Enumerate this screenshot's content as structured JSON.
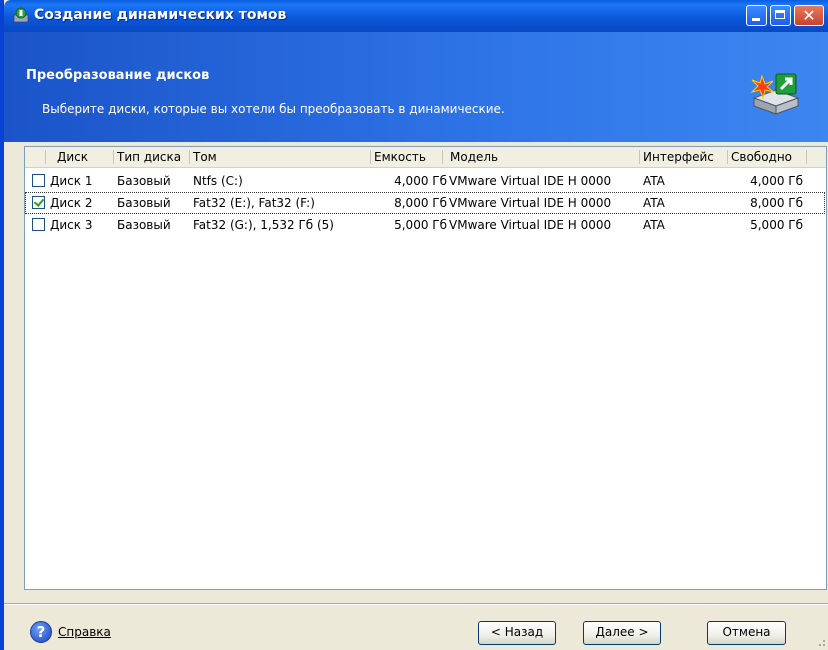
{
  "window": {
    "title": "Создание динамических томов"
  },
  "header": {
    "title": "Преобразование дисков",
    "description": "Выберите диски, которые вы хотели бы преобразовать в динамические."
  },
  "table": {
    "columns": {
      "disk": "Диск",
      "type": "Тип диска",
      "volume": "Том",
      "capacity": "Емкость",
      "model": "Модель",
      "interface": "Интерфейс",
      "free": "Свободно"
    },
    "rows": [
      {
        "checked": false,
        "disk": "Диск 1",
        "type": "Базовый",
        "volume": "Ntfs (C:)",
        "capacity": "4,000 Гб",
        "model": "VMware Virtual IDE H 0000",
        "interface": "ATA",
        "free": "4,000 Гб"
      },
      {
        "checked": true,
        "disk": "Диск 2",
        "type": "Базовый",
        "volume": "Fat32 (E:), Fat32 (F:)",
        "capacity": "8,000 Гб",
        "model": "VMware Virtual IDE H 0000",
        "interface": "ATA",
        "free": "8,000 Гб"
      },
      {
        "checked": false,
        "disk": "Диск 3",
        "type": "Базовый",
        "volume": "Fat32 (G:), 1,532 Гб (5)",
        "capacity": "5,000 Гб",
        "model": "VMware Virtual IDE H 0000",
        "interface": "ATA",
        "free": "5,000 Гб"
      }
    ]
  },
  "footer": {
    "help": "Справка",
    "back": "< Назад",
    "next": "Далее >",
    "cancel": "Отмена"
  },
  "colors": {
    "titlebar": "#0b58d9",
    "header": "#2f75e8",
    "close_button": "#c9432b"
  },
  "icons": [
    "disk-app-icon",
    "minimize-icon",
    "maximize-icon",
    "close-icon",
    "convert-disk-icon",
    "help-icon"
  ]
}
